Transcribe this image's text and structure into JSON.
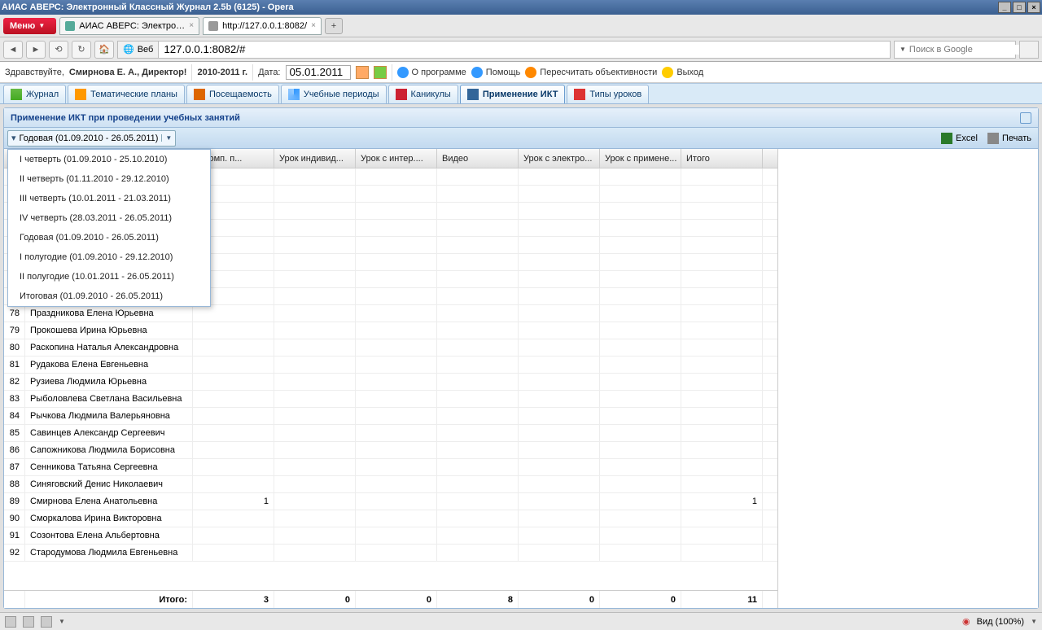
{
  "window": {
    "title": "АИАС АВЕРС: Электронный Классный Журнал 2.5b (6125) - Opera"
  },
  "opera": {
    "menu": "Меню",
    "tabs": [
      {
        "label": "АИАС АВЕРС: Электрон...",
        "active": true
      },
      {
        "label": "http://127.0.0.1:8082/",
        "active": false
      }
    ]
  },
  "address": {
    "web_label": "Веб",
    "url": "127.0.0.1:8082/#",
    "search_placeholder": "Поиск в Google"
  },
  "appbar": {
    "greeting_prefix": "Здравствуйте, ",
    "user": "Смирнова Е. А., Директор!",
    "year": "2010-2011 г.",
    "date_label": "Дата:",
    "date_value": "05.01.2011",
    "about": "О программе",
    "help": "Помощь",
    "recalc": "Пересчитать объективности",
    "exit": "Выход"
  },
  "modtabs": [
    {
      "label": "Журнал",
      "icon": "icon-journal"
    },
    {
      "label": "Тематические планы",
      "icon": "icon-theme"
    },
    {
      "label": "Посещаемость",
      "icon": "icon-attend"
    },
    {
      "label": "Учебные периоды",
      "icon": "icon-period"
    },
    {
      "label": "Каникулы",
      "icon": "icon-holiday"
    },
    {
      "label": "Применение ИКТ",
      "icon": "icon-ikt",
      "active": true
    },
    {
      "label": "Типы уроков",
      "icon": "icon-types"
    }
  ],
  "panel": {
    "title": "Применение ИКТ при проведении учебных занятий",
    "filter_label": "Годовая (01.09.2010 - 26.05.2011)",
    "excel": "Excel",
    "print": "Печать"
  },
  "dropdown": [
    "I четверть (01.09.2010 - 25.10.2010)",
    "II четверть (01.11.2010 - 29.12.2010)",
    "III четверть (10.01.2011 - 21.03.2011)",
    "IV четверть (28.03.2011 - 26.05.2011)",
    "Годовая (01.09.2010 - 26.05.2011)",
    "I полугодие (01.09.2010 - 29.12.2010)",
    "II полугодие (10.01.2011 - 26.05.2011)",
    "Итоговая (01.09.2010 - 26.05.2011)"
  ],
  "grid": {
    "columns": [
      "",
      "",
      "с комп. п...",
      "Урок индивид...",
      "Урок с интер....",
      "Видео",
      "Урок с электро...",
      "Урок с примене...",
      "Итого"
    ],
    "rows": [
      {
        "n": "78",
        "name": "Праздникова Елена Юрьевна"
      },
      {
        "n": "79",
        "name": "Прокошева Ирина Юрьевна"
      },
      {
        "n": "80",
        "name": "Раскопина Наталья Александровна"
      },
      {
        "n": "81",
        "name": "Рудакова Елена Евгеньевна"
      },
      {
        "n": "82",
        "name": "Рузиева Людмила Юрьевна"
      },
      {
        "n": "83",
        "name": "Рыболовлева Светлана Васильевна"
      },
      {
        "n": "84",
        "name": "Рычкова Людмила Валерьяновна"
      },
      {
        "n": "85",
        "name": "Савинцев Александр Сергеевич"
      },
      {
        "n": "86",
        "name": "Сапожникова Людмила Борисовна"
      },
      {
        "n": "87",
        "name": "Сенникова Татьяна Сергеевна"
      },
      {
        "n": "88",
        "name": "Синяговский Денис Николаевич"
      },
      {
        "n": "89",
        "name": "Смирнова Елена Анатольевна",
        "v2": "1",
        "v8": "1"
      },
      {
        "n": "90",
        "name": "Сморкалова Ирина Викторовна"
      },
      {
        "n": "91",
        "name": "Созонтова Елена Альбертовна"
      },
      {
        "n": "92",
        "name": "Стародумова Людмила Евгеньевна"
      }
    ],
    "footer": {
      "label": "Итого:",
      "v2": "3",
      "v3": "0",
      "v4": "0",
      "v5": "8",
      "v6": "0",
      "v7": "0",
      "v8": "11"
    }
  },
  "status": {
    "zoom": "Вид (100%)"
  }
}
